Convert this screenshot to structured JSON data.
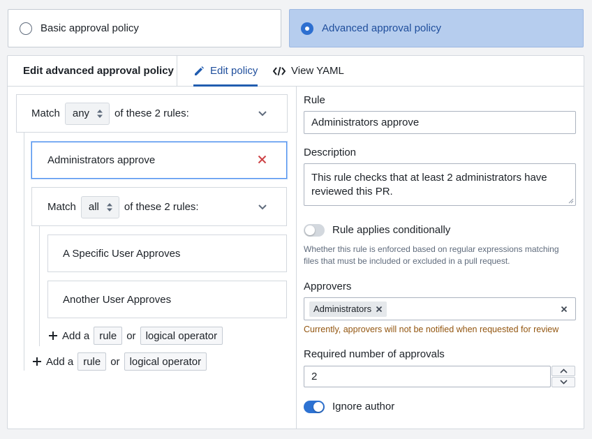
{
  "policy_options": {
    "basic_label": "Basic approval policy",
    "advanced_label": "Advanced approval policy",
    "selected": "advanced"
  },
  "editor": {
    "title": "Edit advanced approval policy",
    "tabs": [
      {
        "label": "Edit policy",
        "icon": "pencil-icon",
        "active": true
      },
      {
        "label": "View YAML",
        "icon": "code-icon",
        "active": false
      }
    ]
  },
  "tree": {
    "root": {
      "match_word": "Match",
      "operator": "any",
      "suffix": "of these 2 rules:"
    },
    "rule_administrators": "Administrators approve",
    "nested": {
      "match_word": "Match",
      "operator": "all",
      "suffix": "of these 2 rules:",
      "rules": [
        "A Specific User Approves",
        "Another User Approves"
      ]
    },
    "add_row": {
      "add_prefix": "Add a",
      "rule_button": "rule",
      "or_word": "or",
      "operator_button": "logical operator"
    }
  },
  "form": {
    "rule_label": "Rule",
    "rule_value": "Administrators approve",
    "description_label": "Description",
    "description_value": "This rule checks that at least 2 administrators have reviewed this PR.",
    "conditional_label": "Rule applies conditionally",
    "conditional_enabled": false,
    "conditional_help": "Whether this rule is enforced based on regular expressions matching files that must be included or excluded in a pull request.",
    "approvers_label": "Approvers",
    "approvers": [
      "Administrators"
    ],
    "approvers_warning": "Currently, approvers will not be notified when requested for review",
    "required_label": "Required number of approvals",
    "required_value": "2",
    "ignore_author_label": "Ignore author",
    "ignore_author_enabled": true
  },
  "colors": {
    "accent": "#2d72d2",
    "selected_card": "#b6cdee",
    "remove_red": "#cd4246",
    "warning": "#935610"
  }
}
